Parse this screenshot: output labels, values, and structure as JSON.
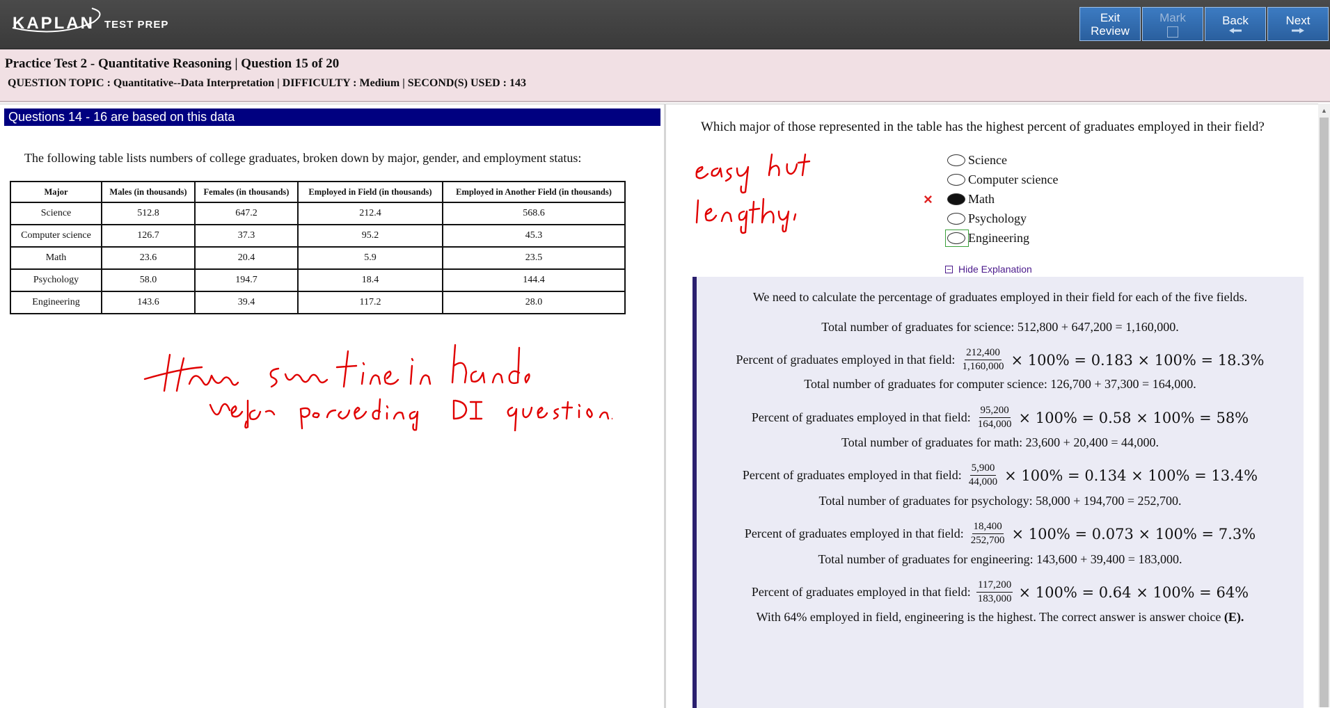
{
  "header": {
    "brand": "KAPLAN",
    "brand_sub": "TEST PREP",
    "buttons": {
      "exit_review_line1": "Exit",
      "exit_review_line2": "Review",
      "mark": "Mark",
      "back": "Back",
      "next": "Next"
    }
  },
  "info": {
    "title": "Practice Test 2 - Quantitative Reasoning | Question  15 of 20",
    "meta": "QUESTION TOPIC : Quantitative--Data Interpretation | DIFFICULTY : Medium | SECOND(S) USED : 143"
  },
  "left": {
    "header": "Questions 14 - 16 are based on this data",
    "passage": "The following table lists numbers of college graduates, broken down by major, gender, and employment status:",
    "table": {
      "columns": [
        "Major",
        "Males (in thousands)",
        "Females (in thousands)",
        "Employed in Field (in thousands)",
        "Employed in Another Field (in thousands)"
      ],
      "rows": [
        [
          "Science",
          "512.8",
          "647.2",
          "212.4",
          "568.6"
        ],
        [
          "Computer science",
          "126.7",
          "37.3",
          "95.2",
          "45.3"
        ],
        [
          "Math",
          "23.6",
          "20.4",
          "5.9",
          "23.5"
        ],
        [
          "Psychology",
          "58.0",
          "194.7",
          "18.4",
          "144.4"
        ],
        [
          "Engineering",
          "143.6",
          "39.4",
          "117.2",
          "28.0"
        ]
      ]
    },
    "handwritten_note": "Have some time in hand before proceeding DI questions."
  },
  "right": {
    "question": "Which major of those represented in the table has the highest percent of graduates employed in their field?",
    "handwritten_note": "easy but lengthy.",
    "choices": [
      "Science",
      "Computer science",
      "Math",
      "Psychology",
      "Engineering"
    ],
    "selected_index": 2,
    "wrong_mark": "×",
    "hide_explanation": "Hide Explanation",
    "explanation": {
      "intro": "We need to calculate the percentage of graduates employed in their field for each of the five fields.",
      "pct_label": "Percent of graduates employed in that field:",
      "items": [
        {
          "total": "Total number of graduates for science: 512,800 + 647,200 = 1,160,000.",
          "num": "212,400",
          "den": "1,160,000",
          "calc": "× 100% = 0.183 × 100% = 18.3%"
        },
        {
          "total": "Total number of graduates for computer science: 126,700 + 37,300 = 164,000.",
          "num": "95,200",
          "den": "164,000",
          "calc": "× 100% = 0.58 × 100% = 58%"
        },
        {
          "total": "Total number of graduates for math: 23,600 + 20,400 = 44,000.",
          "num": "5,900",
          "den": "44,000",
          "calc": "× 100% = 0.134 × 100% = 13.4%"
        },
        {
          "total": "Total number of graduates for psychology: 58,000 + 194,700 = 252,700.",
          "num": "18,400",
          "den": "252,700",
          "calc": "× 100% = 0.073 × 100% = 7.3%"
        },
        {
          "total": "Total number of graduates for engineering: 143,600 + 39,400 = 183,000.",
          "num": "117,200",
          "den": "183,000",
          "calc": "× 100% = 0.64 × 100% = 64%"
        }
      ],
      "conclusion_pre": "With 64% employed in field, engineering is the highest. The correct answer is answer choice",
      "conclusion_answer": "(E)."
    }
  },
  "colors": {
    "topbar": "#3f3f3f",
    "button": "#2f6aad",
    "infobar": "#f1e0e4",
    "question_header": "#000080",
    "explanation_bg": "#ebebf5",
    "explanation_border": "#2a1f6e",
    "ink": "#e00000"
  }
}
